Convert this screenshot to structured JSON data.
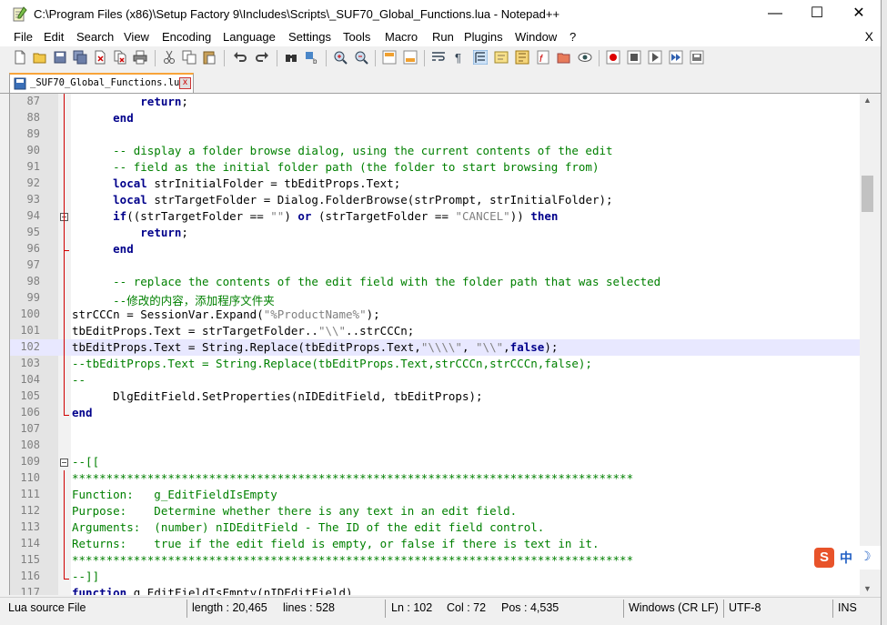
{
  "window": {
    "title": "C:\\Program Files (x86)\\Setup Factory 9\\Includes\\Scripts\\_SUF70_Global_Functions.lua - Notepad++",
    "minimize": "—",
    "maximize": "☐",
    "close": "✕"
  },
  "menu": {
    "items": [
      "File",
      "Edit",
      "Search",
      "View",
      "Encoding",
      "Language",
      "Settings",
      "Tools",
      "Macro",
      "Run",
      "Plugins",
      "Window",
      "?"
    ],
    "doc_close": "X"
  },
  "tab": {
    "label": "_SUF70_Global_Functions.lua",
    "close": "x"
  },
  "editor": {
    "lines": [
      {
        "n": "87",
        "html": "          <span class=\"kw\">return</span>;"
      },
      {
        "n": "88",
        "html": "      <span class=\"kw\">end</span>"
      },
      {
        "n": "89",
        "html": ""
      },
      {
        "n": "90",
        "html": "      <span class=\"cm\">-- display a folder browse dialog, using the current contents of the edit</span>"
      },
      {
        "n": "91",
        "html": "      <span class=\"cm\">-- field as the initial folder path (the folder to start browsing from)</span>"
      },
      {
        "n": "92",
        "html": "      <span class=\"kw\">local</span> strInitialFolder = tbEditProps.Text;"
      },
      {
        "n": "93",
        "html": "      <span class=\"kw\">local</span> strTargetFolder = Dialog.FolderBrowse(strPrompt, strInitialFolder);"
      },
      {
        "n": "94",
        "html": "      <span class=\"kw\">if</span>((strTargetFolder == <span class=\"st\">\"\"</span>) <span class=\"kw\">or</span> (strTargetFolder == <span class=\"st\">\"CANCEL\"</span>)) <span class=\"kw\">then</span>"
      },
      {
        "n": "95",
        "html": "          <span class=\"kw\">return</span>;"
      },
      {
        "n": "96",
        "html": "      <span class=\"kw\">end</span>"
      },
      {
        "n": "97",
        "html": ""
      },
      {
        "n": "98",
        "html": "      <span class=\"cm\">-- replace the contents of the edit field with the folder path that was selected</span>"
      },
      {
        "n": "99",
        "html": "      <span class=\"cm\">--修改的内容，添加程序文件夹</span>"
      },
      {
        "n": "100",
        "html": "strCCCn = SessionVar.Expand(<span class=\"st\">\"%ProductName%\"</span>);"
      },
      {
        "n": "101",
        "html": "tbEditProps.Text = strTargetFolder..<span class=\"st\">\"\\\\\"</span>..strCCCn;"
      },
      {
        "n": "102",
        "html": "tbEditProps.Text = String.Replace(tbEditProps.Text,<span class=\"st\">\"\\\\\\\\\"</span>, <span class=\"st\">\"\\\\\"</span>,<span class=\"kw\">false</span>);"
      },
      {
        "n": "103",
        "html": "<span class=\"cm\">--tbEditProps.Text = String.Replace(tbEditProps.Text,strCCCn,strCCCn,false);</span>"
      },
      {
        "n": "104",
        "html": "<span class=\"cm\">--</span>"
      },
      {
        "n": "105",
        "html": "      DlgEditField.SetProperties(nIDEditField, tbEditProps);"
      },
      {
        "n": "106",
        "html": "<span class=\"kw\">end</span>"
      },
      {
        "n": "107",
        "html": ""
      },
      {
        "n": "108",
        "html": ""
      },
      {
        "n": "109",
        "html": "<span class=\"cm\">--[[</span>"
      },
      {
        "n": "110",
        "html": "<span class=\"cm\">**********************************************************************************</span>"
      },
      {
        "n": "111",
        "html": "<span class=\"cm\">Function:   g_EditFieldIsEmpty</span>"
      },
      {
        "n": "112",
        "html": "<span class=\"cm\">Purpose:    Determine whether there is any text in an edit field.</span>"
      },
      {
        "n": "113",
        "html": "<span class=\"cm\">Arguments:  (number) nIDEditField - The ID of the edit field control.</span>"
      },
      {
        "n": "114",
        "html": "<span class=\"cm\">Returns:    true if the edit field is empty, or false if there is text in it.</span>"
      },
      {
        "n": "115",
        "html": "<span class=\"cm\">**********************************************************************************</span>"
      },
      {
        "n": "116",
        "html": "<span class=\"cm\">--]]</span>"
      },
      {
        "n": "117",
        "html": "<span class=\"kw\">function</span> g_EditFieldIsEmpty(nIDEditField)"
      }
    ]
  },
  "status": {
    "file_type": "Lua source File",
    "length": "length : 20,465",
    "lines": "lines : 528",
    "ln": "Ln : 102",
    "col": "Col : 72",
    "pos": "Pos : 4,535",
    "eol": "Windows (CR LF)",
    "encoding": "UTF-8",
    "mode": "INS"
  },
  "ime": {
    "logo": "S",
    "lang": "中",
    "moon": "☽"
  },
  "colors": {
    "keyword": "#00008b",
    "comment": "#008000",
    "string": "#808080",
    "current_line": "#e8e8ff",
    "tab_accent": "#f8a43a"
  }
}
